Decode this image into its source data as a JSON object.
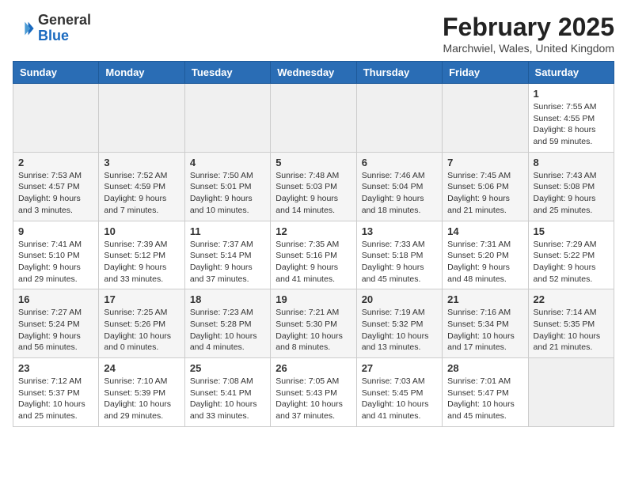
{
  "header": {
    "logo_general": "General",
    "logo_blue": "Blue",
    "month_title": "February 2025",
    "location": "Marchwiel, Wales, United Kingdom"
  },
  "weekdays": [
    "Sunday",
    "Monday",
    "Tuesday",
    "Wednesday",
    "Thursday",
    "Friday",
    "Saturday"
  ],
  "weeks": [
    [
      {
        "day": "",
        "info": ""
      },
      {
        "day": "",
        "info": ""
      },
      {
        "day": "",
        "info": ""
      },
      {
        "day": "",
        "info": ""
      },
      {
        "day": "",
        "info": ""
      },
      {
        "day": "",
        "info": ""
      },
      {
        "day": "1",
        "info": "Sunrise: 7:55 AM\nSunset: 4:55 PM\nDaylight: 8 hours and 59 minutes."
      }
    ],
    [
      {
        "day": "2",
        "info": "Sunrise: 7:53 AM\nSunset: 4:57 PM\nDaylight: 9 hours and 3 minutes."
      },
      {
        "day": "3",
        "info": "Sunrise: 7:52 AM\nSunset: 4:59 PM\nDaylight: 9 hours and 7 minutes."
      },
      {
        "day": "4",
        "info": "Sunrise: 7:50 AM\nSunset: 5:01 PM\nDaylight: 9 hours and 10 minutes."
      },
      {
        "day": "5",
        "info": "Sunrise: 7:48 AM\nSunset: 5:03 PM\nDaylight: 9 hours and 14 minutes."
      },
      {
        "day": "6",
        "info": "Sunrise: 7:46 AM\nSunset: 5:04 PM\nDaylight: 9 hours and 18 minutes."
      },
      {
        "day": "7",
        "info": "Sunrise: 7:45 AM\nSunset: 5:06 PM\nDaylight: 9 hours and 21 minutes."
      },
      {
        "day": "8",
        "info": "Sunrise: 7:43 AM\nSunset: 5:08 PM\nDaylight: 9 hours and 25 minutes."
      }
    ],
    [
      {
        "day": "9",
        "info": "Sunrise: 7:41 AM\nSunset: 5:10 PM\nDaylight: 9 hours and 29 minutes."
      },
      {
        "day": "10",
        "info": "Sunrise: 7:39 AM\nSunset: 5:12 PM\nDaylight: 9 hours and 33 minutes."
      },
      {
        "day": "11",
        "info": "Sunrise: 7:37 AM\nSunset: 5:14 PM\nDaylight: 9 hours and 37 minutes."
      },
      {
        "day": "12",
        "info": "Sunrise: 7:35 AM\nSunset: 5:16 PM\nDaylight: 9 hours and 41 minutes."
      },
      {
        "day": "13",
        "info": "Sunrise: 7:33 AM\nSunset: 5:18 PM\nDaylight: 9 hours and 45 minutes."
      },
      {
        "day": "14",
        "info": "Sunrise: 7:31 AM\nSunset: 5:20 PM\nDaylight: 9 hours and 48 minutes."
      },
      {
        "day": "15",
        "info": "Sunrise: 7:29 AM\nSunset: 5:22 PM\nDaylight: 9 hours and 52 minutes."
      }
    ],
    [
      {
        "day": "16",
        "info": "Sunrise: 7:27 AM\nSunset: 5:24 PM\nDaylight: 9 hours and 56 minutes."
      },
      {
        "day": "17",
        "info": "Sunrise: 7:25 AM\nSunset: 5:26 PM\nDaylight: 10 hours and 0 minutes."
      },
      {
        "day": "18",
        "info": "Sunrise: 7:23 AM\nSunset: 5:28 PM\nDaylight: 10 hours and 4 minutes."
      },
      {
        "day": "19",
        "info": "Sunrise: 7:21 AM\nSunset: 5:30 PM\nDaylight: 10 hours and 8 minutes."
      },
      {
        "day": "20",
        "info": "Sunrise: 7:19 AM\nSunset: 5:32 PM\nDaylight: 10 hours and 13 minutes."
      },
      {
        "day": "21",
        "info": "Sunrise: 7:16 AM\nSunset: 5:34 PM\nDaylight: 10 hours and 17 minutes."
      },
      {
        "day": "22",
        "info": "Sunrise: 7:14 AM\nSunset: 5:35 PM\nDaylight: 10 hours and 21 minutes."
      }
    ],
    [
      {
        "day": "23",
        "info": "Sunrise: 7:12 AM\nSunset: 5:37 PM\nDaylight: 10 hours and 25 minutes."
      },
      {
        "day": "24",
        "info": "Sunrise: 7:10 AM\nSunset: 5:39 PM\nDaylight: 10 hours and 29 minutes."
      },
      {
        "day": "25",
        "info": "Sunrise: 7:08 AM\nSunset: 5:41 PM\nDaylight: 10 hours and 33 minutes."
      },
      {
        "day": "26",
        "info": "Sunrise: 7:05 AM\nSunset: 5:43 PM\nDaylight: 10 hours and 37 minutes."
      },
      {
        "day": "27",
        "info": "Sunrise: 7:03 AM\nSunset: 5:45 PM\nDaylight: 10 hours and 41 minutes."
      },
      {
        "day": "28",
        "info": "Sunrise: 7:01 AM\nSunset: 5:47 PM\nDaylight: 10 hours and 45 minutes."
      },
      {
        "day": "",
        "info": ""
      }
    ]
  ]
}
